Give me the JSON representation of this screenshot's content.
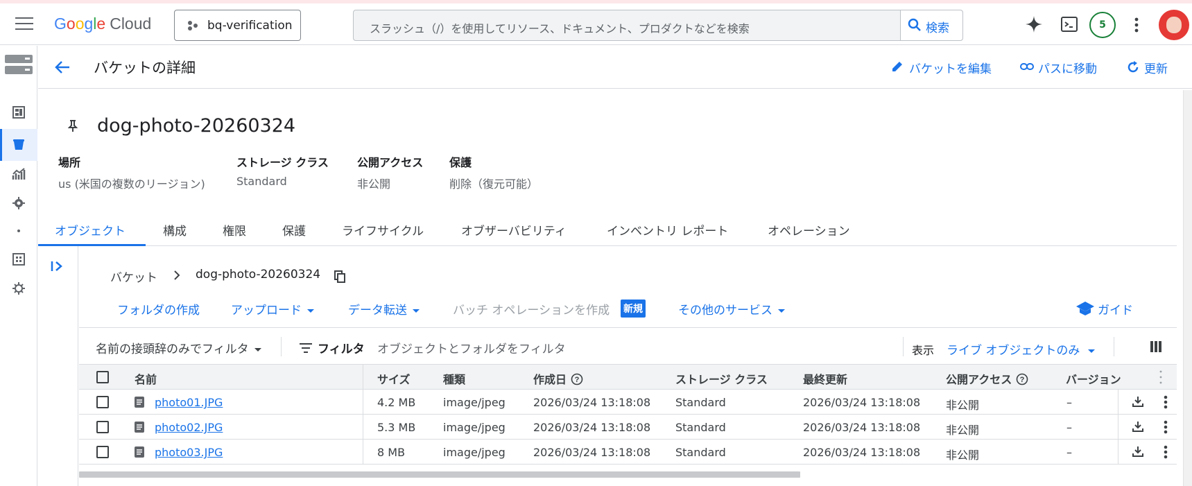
{
  "topbar": {
    "logo": {
      "g1": "G",
      "g2": "o",
      "g3": "o",
      "g4": "g",
      "g5": "l",
      "g6": "e",
      "cloud": "Cloud"
    },
    "project": "bq-verification",
    "search_placeholder": "スラッシュ（/）を使用してリソース、ドキュメント、プロダクトなどを検索",
    "search_button": "検索",
    "notification_count": "5"
  },
  "header": {
    "title": "バケットの詳細",
    "edit": "バケットを編集",
    "goto_path": "パスに移動",
    "refresh": "更新"
  },
  "bucket": {
    "name": "dog-photo-20260324",
    "meta": [
      {
        "label": "場所",
        "value": "us (米国の複数のリージョン)"
      },
      {
        "label": "ストレージ クラス",
        "value": "Standard"
      },
      {
        "label": "公開アクセス",
        "value": "非公開"
      },
      {
        "label": "保護",
        "value": "削除（復元可能）"
      }
    ]
  },
  "tabs": [
    "オブジェクト",
    "構成",
    "権限",
    "保護",
    "ライフサイクル",
    "オブザーバビリティ",
    "インベントリ レポート",
    "オペレーション"
  ],
  "breadcrumb": {
    "root": "バケット",
    "current": "dog-photo-20260324"
  },
  "actions": {
    "create_folder": "フォルダの作成",
    "upload": "アップロード",
    "transfer": "データ転送",
    "batch": "バッチ オペレーションを作成",
    "new_badge": "新規",
    "other": "その他のサービス",
    "guide": "ガイド"
  },
  "filter": {
    "prefix": "名前の接頭辞のみでフィルタ",
    "label": "フィルタ",
    "placeholder": "オブジェクトとフォルダをフィルタ",
    "show_label": "表示",
    "show_value": "ライブ オブジェクトのみ"
  },
  "table": {
    "columns": [
      "名前",
      "サイズ",
      "種類",
      "作成日",
      "ストレージ クラス",
      "最終更新",
      "公開アクセス",
      "バージョン"
    ],
    "rows": [
      {
        "name": "photo01.JPG",
        "size": "4.2 MB",
        "type": "image/jpeg",
        "created": "2026/03/24 13:18:08",
        "storage": "Standard",
        "updated": "2026/03/24 13:18:08",
        "access": "非公開",
        "version": "–"
      },
      {
        "name": "photo02.JPG",
        "size": "5.3 MB",
        "type": "image/jpeg",
        "created": "2026/03/24 13:18:08",
        "storage": "Standard",
        "updated": "2026/03/24 13:18:08",
        "access": "非公開",
        "version": "–"
      },
      {
        "name": "photo03.JPG",
        "size": "8 MB",
        "type": "image/jpeg",
        "created": "2026/03/24 13:18:08",
        "storage": "Standard",
        "updated": "2026/03/24 13:18:08",
        "access": "非公開",
        "version": "–"
      }
    ]
  }
}
